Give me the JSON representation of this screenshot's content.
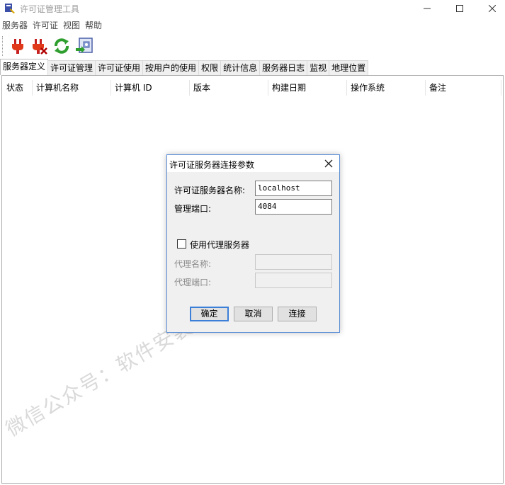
{
  "window": {
    "title": "许可证管理工具"
  },
  "menu": [
    "服务器",
    "许可证",
    "视图",
    "帮助"
  ],
  "toolbar": [
    {
      "icon": "plug-connect-icon"
    },
    {
      "icon": "plug-disconnect-icon"
    },
    {
      "icon": "refresh-icon"
    },
    {
      "icon": "import-file-icon"
    }
  ],
  "tabs": [
    "服务器定义",
    "许可证管理",
    "许可证使用",
    "按用户的使用",
    "权限",
    "统计信息",
    "服务器日志",
    "监视",
    "地理位置"
  ],
  "list": {
    "columns": [
      "状态",
      "计算机名称",
      "计算机 ID",
      "版本",
      "构建日期",
      "操作系统",
      "备注"
    ]
  },
  "watermark": "微信公众号：软件安装管家",
  "dialog": {
    "title": "许可证服务器连接参数",
    "server_name_label": "许可证服务器名称:",
    "server_name_value": "localhost",
    "port_label": "管理端口:",
    "port_value": "4084",
    "proxy_checkbox_label": "使用代理服务器",
    "proxy_checked": false,
    "proxy_name_label": "代理名称:",
    "proxy_port_label": "代理端口:",
    "ok": "确定",
    "cancel": "取消",
    "connect": "连接"
  }
}
